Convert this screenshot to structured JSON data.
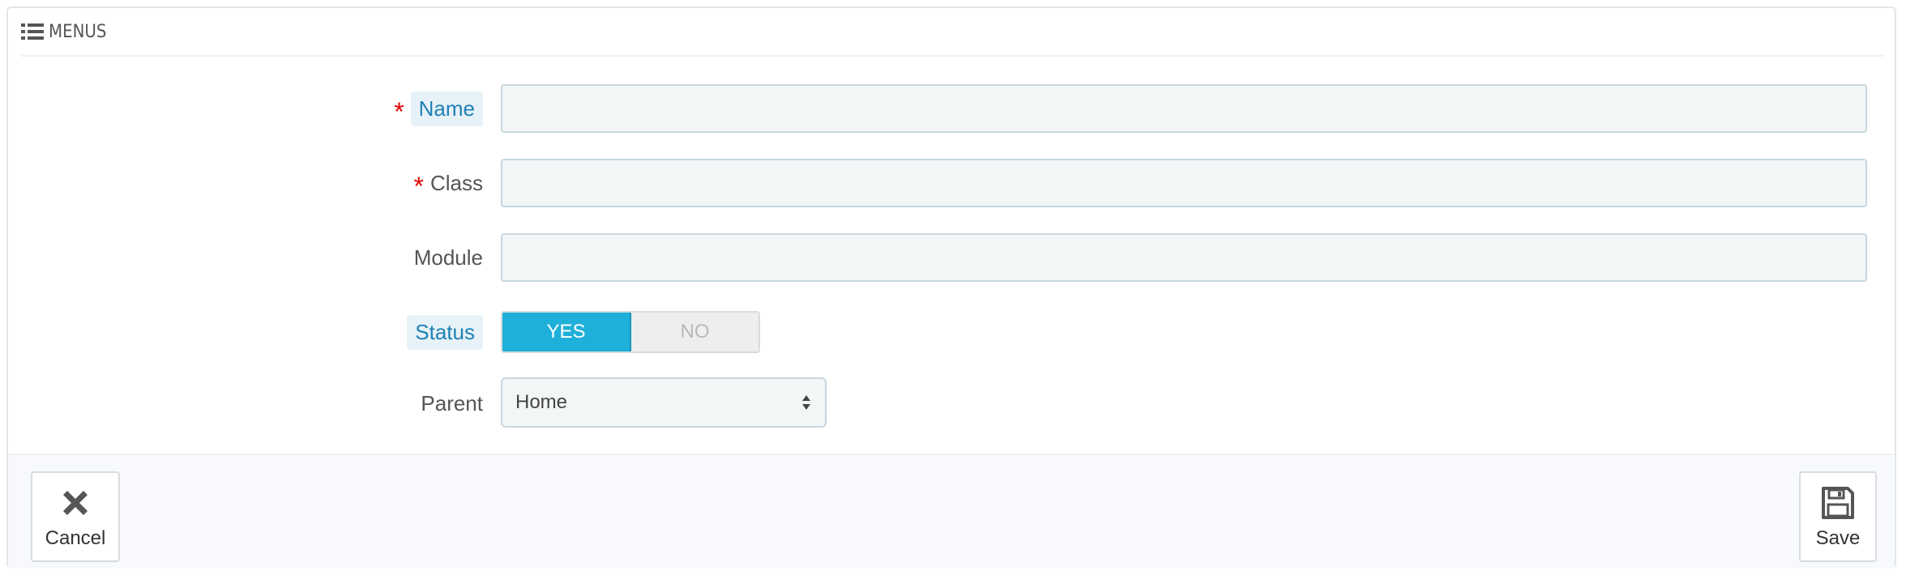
{
  "panel": {
    "title": "MENUS",
    "icon": "list-icon"
  },
  "form": {
    "name": {
      "label": "Name",
      "required": "*",
      "value": ""
    },
    "class": {
      "label": "Class",
      "required": "*",
      "value": ""
    },
    "module": {
      "label": "Module",
      "value": ""
    },
    "status": {
      "label": "Status",
      "yes": "YES",
      "no": "NO",
      "selected": "YES"
    },
    "parent": {
      "label": "Parent",
      "selected": "Home"
    }
  },
  "footer": {
    "cancel_label": "Cancel",
    "cancel_icon": "close-icon",
    "save_label": "Save",
    "save_icon": "floppy-disk-icon"
  },
  "colors": {
    "accent": "#1fb0d9",
    "required": "#e40000",
    "hint_label": "#2081b5"
  }
}
